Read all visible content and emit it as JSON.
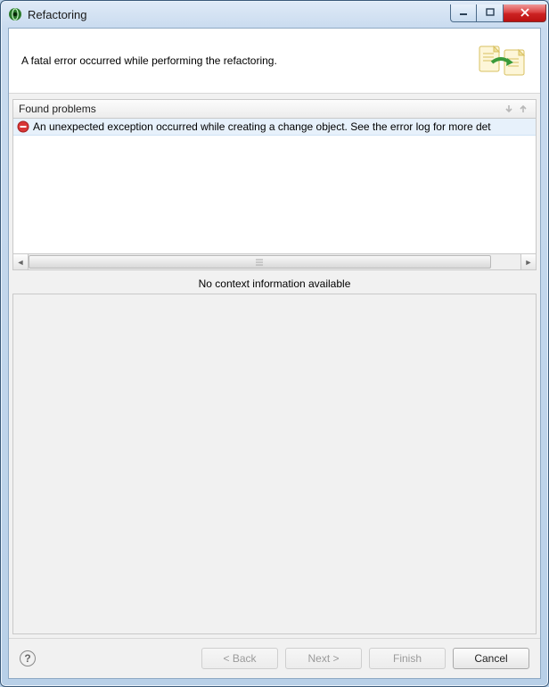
{
  "window": {
    "title": "Refactoring"
  },
  "header": {
    "message": "A fatal error occurred while performing the refactoring."
  },
  "problems": {
    "header_label": "Found problems",
    "items": [
      {
        "text": "An unexpected exception occurred while creating a change object. See the error log for more det"
      }
    ]
  },
  "context": {
    "empty_label": "No context information available"
  },
  "footer": {
    "back_label": "< Back",
    "next_label": "Next >",
    "finish_label": "Finish",
    "cancel_label": "Cancel"
  }
}
